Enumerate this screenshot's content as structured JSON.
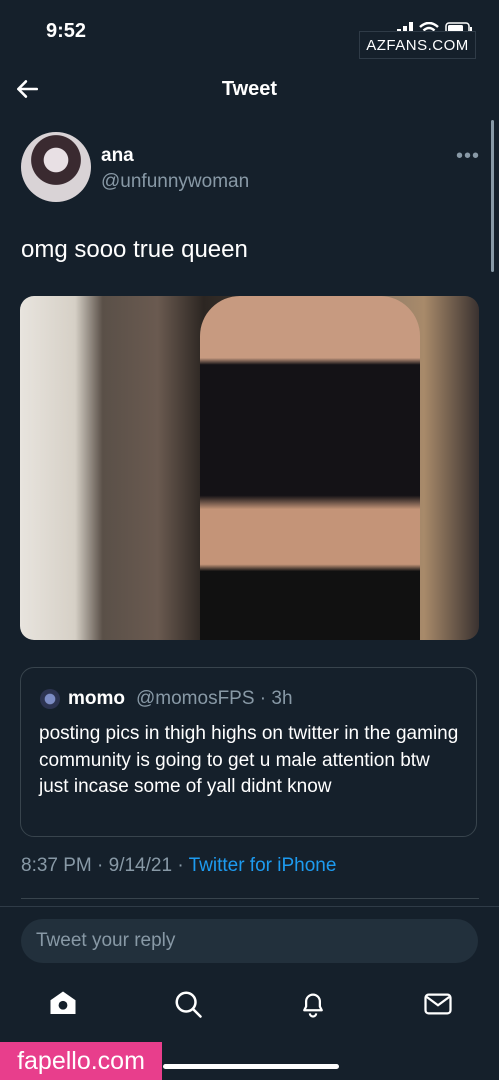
{
  "status_bar": {
    "time": "9:52"
  },
  "watermarks": {
    "top": "AZFANS.COM",
    "bottom": "fapello.com"
  },
  "header": {
    "title": "Tweet",
    "back_icon": "arrow-left-icon"
  },
  "tweet": {
    "author_name": "ana",
    "author_handle": "@unfunnywoman",
    "more_label": "•••",
    "text": "omg sooo true queen",
    "photo_alt": "photo",
    "quote": {
      "name": "momo",
      "handle_time": "@momosFPS · 3h",
      "text": "posting pics in thigh highs on twitter in the gaming community is going to get u male attention btw just incase some of yall didnt know"
    },
    "meta": {
      "time": "8:37 PM · 9/14/21 · ",
      "source": "Twitter for iPhone"
    }
  },
  "reply": {
    "placeholder": "Tweet your reply"
  },
  "nav": {
    "items": [
      "home-icon",
      "search-icon",
      "notifications-icon",
      "messages-icon"
    ]
  },
  "colors": {
    "background": "#15202b",
    "accent": "#1d9bf0",
    "muted": "#8899a6",
    "border": "#38444d"
  }
}
